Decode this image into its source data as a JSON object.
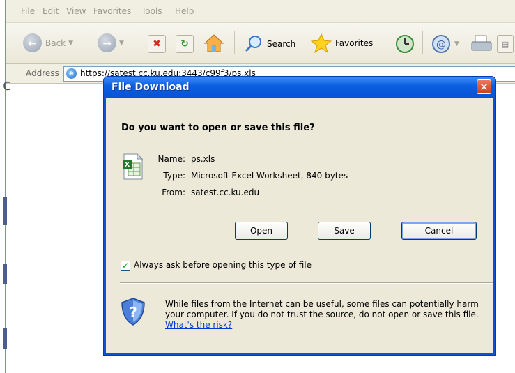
{
  "menu": [
    "File",
    "Edit",
    "View",
    "Favorites",
    "Tools",
    "Help"
  ],
  "toolbar": {
    "back_label": "Back",
    "search_label": "Search",
    "favorites_label": "Favorites"
  },
  "address": {
    "label": "Address",
    "url": "https://satest.cc.ku.edu:3443/c99f3/ps.xls"
  },
  "dialog": {
    "title": "File Download",
    "question": "Do you want to open or save this file?",
    "fields": [
      {
        "key": "Name:",
        "value": "ps.xls"
      },
      {
        "key": "Type:",
        "value": "Microsoft Excel Worksheet, 840 bytes"
      },
      {
        "key": "From:",
        "value": "satest.cc.ku.edu"
      }
    ],
    "buttons": {
      "open": "Open",
      "save": "Save",
      "cancel": "Cancel"
    },
    "checkbox": {
      "label": "Always ask before opening this type of file",
      "checked": true
    },
    "warning": {
      "text": "While files from the Internet can be useful, some files can potentially harm your computer. If you do not trust the source, do not open or save this file.",
      "link": "What's the risk?"
    }
  },
  "colors": {
    "title_bar": "#0a5fe0",
    "dialog_face": "#ece9d8",
    "link": "#0b37d6"
  }
}
